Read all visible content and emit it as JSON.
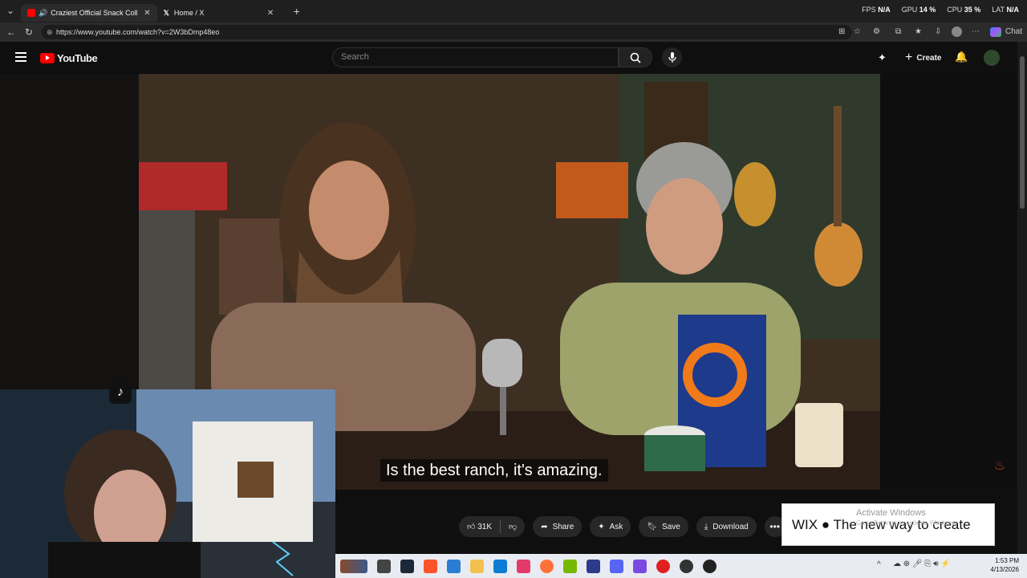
{
  "browser": {
    "tabs": [
      {
        "title": "Craziest Official Snack Collab",
        "active": true,
        "favicon": "youtube-favicon"
      },
      {
        "title": "Home / X",
        "active": false,
        "favicon": "x-favicon"
      }
    ],
    "new_tab_symbol": "+",
    "perf": {
      "fps_label": "FPS",
      "fps": "N/A",
      "gpu_label": "GPU",
      "gpu": "14 %",
      "cpu_label": "CPU",
      "cpu": "35 %",
      "lat_label": "LAT",
      "lat": "N/A"
    },
    "url": "https://www.youtube.com/watch?v=2W3bDmp48eo",
    "chat_label": "Chat"
  },
  "youtube": {
    "logo_text": "YouTube",
    "search_placeholder": "Search",
    "create_label": "Create"
  },
  "video": {
    "caption": "Is the best ranch, it's amazing."
  },
  "actions": {
    "like_count": "31K",
    "share_label": "Share",
    "ask_label": "Ask",
    "save_label": "Save",
    "download_label": "Download",
    "more_symbol": "•••"
  },
  "ad": {
    "text": "WIX ● The new way to create",
    "watermark": "Activate Windows",
    "watermark_sub": "Go to Settings to activate Windows."
  },
  "taskbar": {
    "time": "1:53 PM",
    "date": "4/13/2026",
    "chevron": "^"
  },
  "colors": {
    "accent": "#ff0000",
    "background": "#0f0f0f",
    "taskbar": "#e8ecf2"
  }
}
